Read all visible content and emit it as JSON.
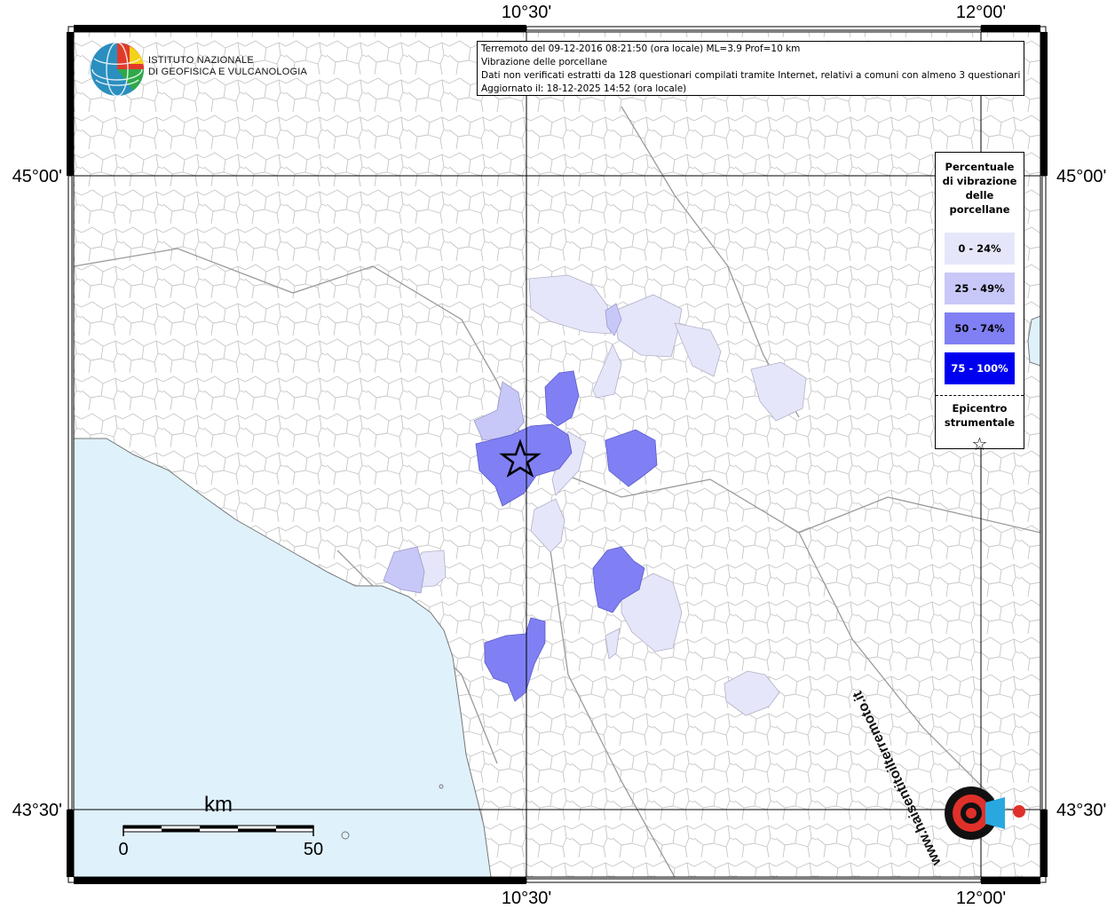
{
  "header": {
    "line1": "Terremoto del 09-12-2016 08:21:50 (ora locale) ML=3.9 Prof=10 km",
    "line2": "Vibrazione delle porcellane",
    "line3": "Dati non verificati estratti da 128 questionari compilati tramite Internet, relativi a comuni con almeno 3 questionari.",
    "line4": "Aggiornato il: 18-12-2025 14:52 (ora locale)"
  },
  "logo": {
    "line1": "ISTITUTO NAZIONALE",
    "line2": "DI GEOFISICA E VULCANOLOGIA"
  },
  "axes": {
    "lon_ticks": [
      "10°30'",
      "12°00'"
    ],
    "lat_ticks": [
      "45°00'",
      "43°30'"
    ]
  },
  "scale_bar": {
    "unit": "km",
    "start": "0",
    "end": "50"
  },
  "legend": {
    "title_lines": [
      "Percentuale",
      "di vibrazione",
      "delle",
      "porcellane"
    ],
    "classes": [
      {
        "label": "0 - 24%",
        "color": "#e6e6fa",
        "text_color": "#000000"
      },
      {
        "label": "25 - 49%",
        "color": "#c8c8f8",
        "text_color": "#000000"
      },
      {
        "label": "50 - 74%",
        "color": "#8080f4",
        "text_color": "#000000"
      },
      {
        "label": "75 - 100%",
        "color": "#0000f0",
        "text_color": "#ffffff"
      }
    ],
    "epicenter_lines": [
      "Epicentro",
      "strumentale"
    ],
    "epicenter_symbol": "☆"
  },
  "colors": {
    "sea": "#dff1fb",
    "land": "#ffffff",
    "border": "#a8a8a8"
  },
  "watermark": {
    "text": "www.haisentitoilterremoto.it"
  }
}
